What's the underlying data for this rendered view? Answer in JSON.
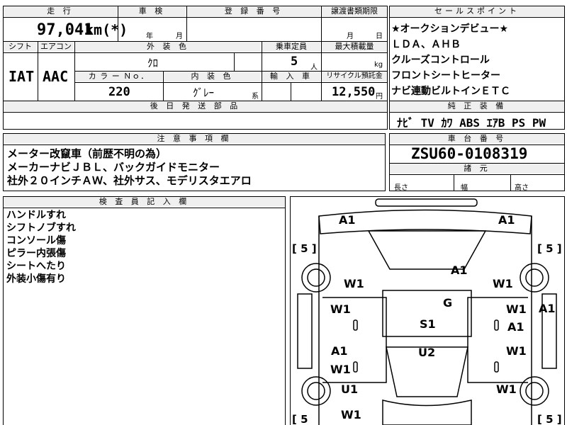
{
  "header": {
    "mileage_label": "走 行",
    "shaken_label": "車 検",
    "registration_label": "登 録 番 号",
    "transfer_label": "譲渡書類期限",
    "sales_point_label": "セールスポイント"
  },
  "mileage": {
    "value": "97,041",
    "unit": "km(*)"
  },
  "shaken": {
    "year": "年",
    "month": "月"
  },
  "transfer": {
    "month": "月",
    "day": "日"
  },
  "sales_points": [
    "★オークションデビュー★",
    "ＬＤＡ、ＡＨＢ",
    "クルーズコントロール",
    "フロントシートヒーター",
    "ナビ連動ビルトインＥＴＣ"
  ],
  "row2": {
    "shift_label": "シフト",
    "ac_label": "エアコン",
    "color_label": "外 装 色",
    "capacity_label": "乗車定員",
    "max_load_label": "最大積載量",
    "shift": "IAT",
    "ac": "AAC",
    "color": "ｸﾛ",
    "capacity": "5",
    "capacity_unit": "人",
    "load_unit": "kg",
    "color_no_label": "カ ラ ー Ｎｏ．",
    "interior_label": "内 装 色",
    "import_label": "輸 入 車",
    "recycle_label": "リサイクル預託金",
    "color_no": "220",
    "interior": "ｸﾞﾚｰ",
    "interior_suffix": "系",
    "recycle": "12,550",
    "recycle_unit": "円"
  },
  "equipment_label": "純 正 装 備",
  "equipment": "ﾅﾋﾞ TV ｶﾜ ABS ｴｱB PS PW",
  "later_parts_label": "後 日 発 送 部 品",
  "notes_label": "注 意 事 項 欄",
  "notes": [
    "メーター改竄車（前歴不明の為）",
    "メーカーナビＪＢＬ、バックガイドモニター",
    "社外２０インチＡＷ、社外サス、モデリスタエアロ"
  ],
  "chassis_label": "車 台 番 号",
  "chassis": "ZSU60-0108319",
  "dims_label": "諸 元",
  "dims": {
    "length": "長さ",
    "width": "幅",
    "height": "高さ"
  },
  "inspector_label": "検 査 員 記 入 欄",
  "inspector_notes": [
    "ハンドルすれ",
    "シフトノブすれ",
    "コンソール傷",
    "ピラー内張傷",
    "シートへたり",
    "外装小傷有り"
  ],
  "diagram": {
    "tire_marks": [
      "[ 5 ]",
      "[ 5 ]",
      "[ 5",
      "[ 5 ]"
    ],
    "labels": [
      "A1",
      "A1",
      "A1",
      "W1",
      "W1",
      "G",
      "W1",
      "W1",
      "A1",
      "A1",
      "S1",
      "A1",
      "W1",
      "W1",
      "U2",
      "W1",
      "U1",
      "W1",
      "W1",
      "A1"
    ]
  }
}
